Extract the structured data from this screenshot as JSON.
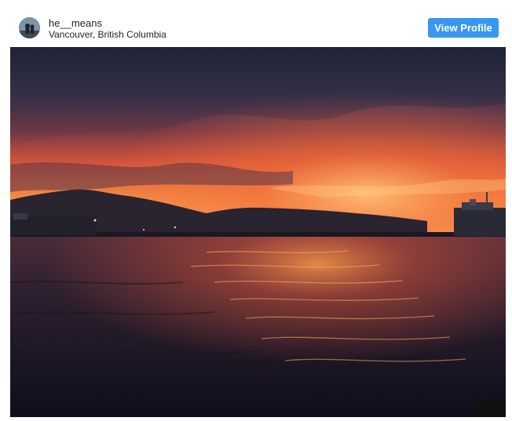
{
  "post": {
    "username": "he__means",
    "location": "Vancouver, British Columbia",
    "view_profile_label": "View Profile"
  },
  "colors": {
    "button_bg": "#3897f0",
    "button_text": "#ffffff",
    "text": "#262626"
  },
  "icons": {
    "avatar": "profile-photo"
  }
}
